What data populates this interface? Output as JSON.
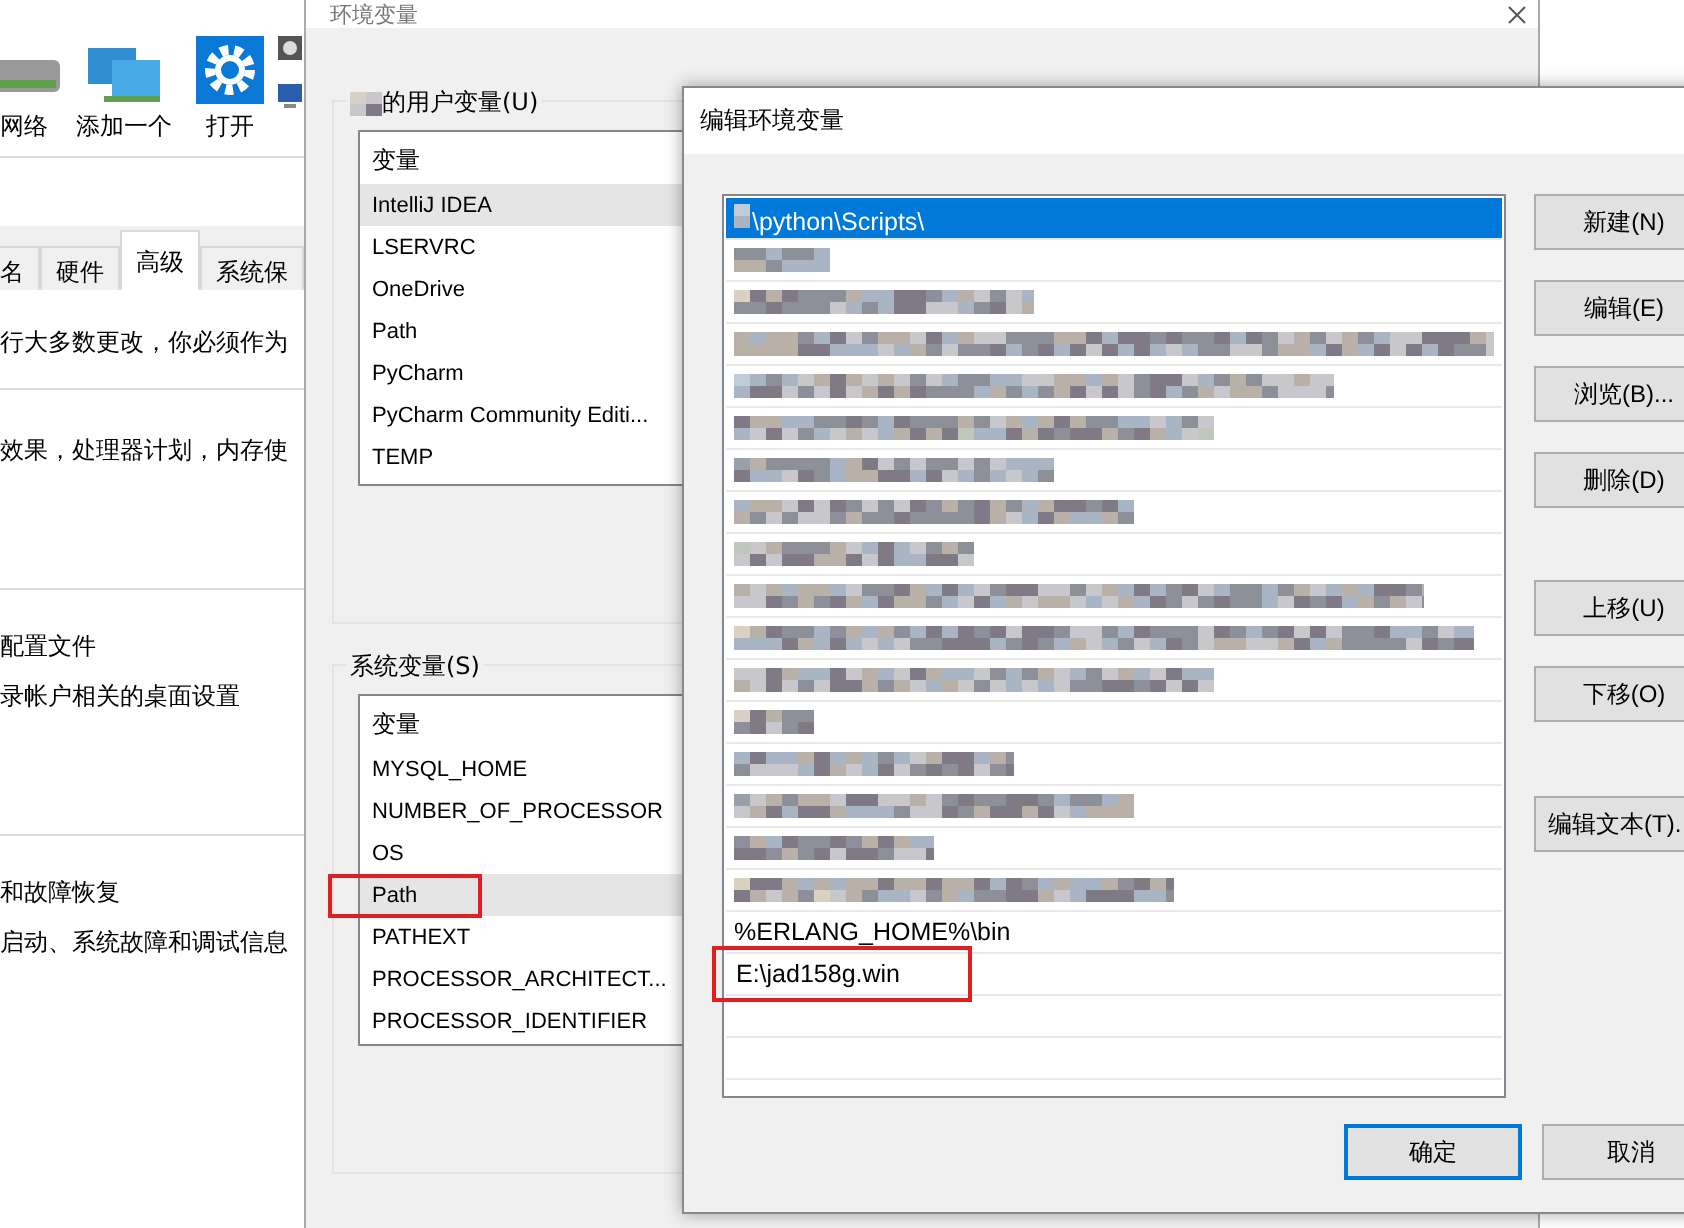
{
  "system_properties": {
    "toolbar": [
      {
        "label": "网络"
      },
      {
        "label": "添加一个"
      },
      {
        "label": "打开"
      }
    ],
    "tabs": [
      {
        "label": "名",
        "selected": false
      },
      {
        "label": "硬件",
        "selected": false
      },
      {
        "label": "高级",
        "selected": true
      },
      {
        "label": "系统保",
        "selected": false
      }
    ],
    "blocks": [
      {
        "kind": "note",
        "text": "行大多数更改，你必须作为"
      },
      {
        "kind": "rule"
      },
      {
        "kind": "note",
        "text": "效果，处理器计划，内存使"
      },
      {
        "kind": "heading",
        "text": "配置文件"
      },
      {
        "kind": "note",
        "text": "录帐户相关的桌面设置"
      },
      {
        "kind": "heading",
        "text": "和故障恢复"
      },
      {
        "kind": "note",
        "text": "启动、系统故障和调试信息"
      }
    ]
  },
  "environment_variables": {
    "title": "环境变量",
    "user_group": {
      "label": "的用户变量(U)",
      "owner_redacted": true,
      "column": "变量",
      "rows": [
        {
          "name": "IntelliJ IDEA",
          "selected": true,
          "highlighted": false
        },
        {
          "name": "LSERVRC",
          "selected": false,
          "highlighted": false
        },
        {
          "name": "OneDrive",
          "selected": false,
          "highlighted": false
        },
        {
          "name": "Path",
          "selected": false,
          "highlighted": false
        },
        {
          "name": "PyCharm",
          "selected": false,
          "highlighted": false
        },
        {
          "name": "PyCharm Community Editi...",
          "selected": false,
          "highlighted": false
        },
        {
          "name": "TEMP",
          "selected": false,
          "highlighted": false
        }
      ]
    },
    "system_group": {
      "label": "系统变量(S)",
      "owner_redacted": false,
      "column": "变量",
      "rows": [
        {
          "name": "MYSQL_HOME",
          "selected": false,
          "highlighted": false
        },
        {
          "name": "NUMBER_OF_PROCESSOR",
          "selected": false,
          "highlighted": false
        },
        {
          "name": "OS",
          "selected": false,
          "highlighted": false
        },
        {
          "name": "Path",
          "selected": true,
          "highlighted": true
        },
        {
          "name": "PATHEXT",
          "selected": false,
          "highlighted": false
        },
        {
          "name": "PROCESSOR_ARCHITECT...",
          "selected": false,
          "highlighted": false
        },
        {
          "name": "PROCESSOR_IDENTIFIER",
          "selected": false,
          "highlighted": false
        }
      ]
    }
  },
  "edit_dialog": {
    "title": "编辑环境变量",
    "entries": [
      {
        "kind": "text",
        "text": "\\python\\Scripts\\",
        "redacted_prefix": true,
        "selected": true,
        "highlighted": false
      },
      {
        "kind": "redacted",
        "selected": false
      },
      {
        "kind": "redacted",
        "selected": false
      },
      {
        "kind": "redacted",
        "selected": false
      },
      {
        "kind": "redacted",
        "selected": false
      },
      {
        "kind": "redacted",
        "selected": false
      },
      {
        "kind": "redacted",
        "selected": false
      },
      {
        "kind": "redacted",
        "selected": false
      },
      {
        "kind": "redacted",
        "selected": false
      },
      {
        "kind": "redacted",
        "selected": false
      },
      {
        "kind": "redacted",
        "selected": false
      },
      {
        "kind": "redacted",
        "selected": false
      },
      {
        "kind": "redacted",
        "selected": false
      },
      {
        "kind": "redacted",
        "selected": false
      },
      {
        "kind": "redacted",
        "selected": false
      },
      {
        "kind": "redacted",
        "selected": false
      },
      {
        "kind": "redacted",
        "selected": false
      },
      {
        "kind": "text",
        "text": "%ERLANG_HOME%\\bin",
        "redacted_prefix": false,
        "selected": false,
        "highlighted": false
      },
      {
        "kind": "text",
        "text": "E:\\jad158g.win",
        "redacted_prefix": false,
        "selected": false,
        "highlighted": true
      }
    ],
    "button_groups": [
      [
        "新建(N)",
        "编辑(E)",
        "浏览(B)...",
        "删除(D)"
      ],
      [
        "上移(U)",
        "下移(O)"
      ],
      [
        "编辑文本(T)."
      ]
    ],
    "footer": [
      {
        "label": "确定",
        "default": true
      },
      {
        "label": "取消",
        "default": false
      }
    ]
  }
}
